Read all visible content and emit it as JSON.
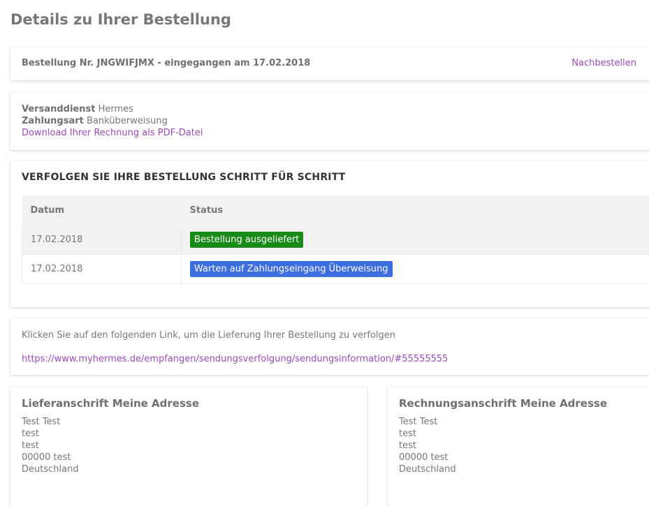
{
  "page_title": "Details zu Ihrer Bestellung",
  "order": {
    "summary": "Bestellung Nr. JNGWIFJMX - eingegangen am 17.02.2018",
    "reorder_link": "Nachbestellen"
  },
  "shipping": {
    "service_label": "Versanddienst",
    "service_value": "Hermes",
    "payment_label": "Zahlungsart",
    "payment_value": "Banküberweisung",
    "invoice_link": "Download Ihrer Rechnung als PDF-Datei"
  },
  "tracking": {
    "title": "VERFOLGEN SIE IHRE BESTELLUNG SCHRITT FÜR SCHRITT",
    "columns": [
      "Datum",
      "Status"
    ],
    "rows": [
      {
        "date": "17.02.2018",
        "status": "Bestellung ausgeliefert",
        "status_color": "#178a17"
      },
      {
        "date": "17.02.2018",
        "status": "Warten auf Zahlungseingang Überweisung",
        "status_color": "#3d6ee0"
      }
    ]
  },
  "follow": {
    "text": "Klicken Sie auf den folgenden Link, um die Lieferung Ihrer Bestellung zu verfolgen",
    "link": "https://www.myhermes.de/empfangen/sendungsverfolgung/sendungsinformation/#55555555"
  },
  "delivery_address": {
    "title": "Lieferanschrift Meine Adresse",
    "lines": [
      "Test Test",
      "test",
      "test",
      "00000 test",
      "Deutschland"
    ]
  },
  "billing_address": {
    "title": "Rechnungsanschrift Meine Adresse",
    "lines": [
      "Test Test",
      "test",
      "test",
      "00000 test",
      "Deutschland"
    ]
  },
  "colors": {
    "accent_link": "#9b4bb8",
    "badge_green": "#178a17",
    "badge_blue": "#3d6ee0"
  }
}
